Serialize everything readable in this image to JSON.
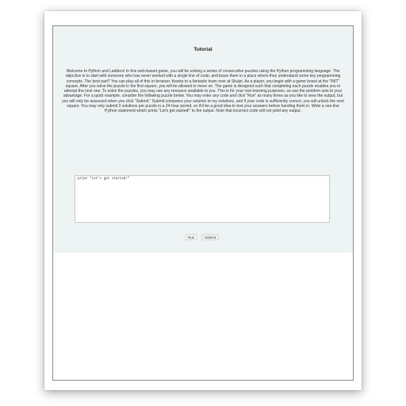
{
  "tutorial": {
    "title": "Tutorial",
    "body": "Welcome to Python and Ladders! In this web-based game, you will be solving a series of consecutive puzzles using the Python programming language. The objective is to start with someone who has never worked with a single line of code, and leave them in a place where they understand some key programming concepts. The best part? You can play all of this in-browser, thanks to a fantastic team over at Skulpt. As a player, you begin with a game board at the \"INIT\" square. After you solve the puzzle in the first square, you will be allowed to move on. The game is designed such that completing each puzzle enables you to attempt the next one. To solve the puzzles, you may use any resource available to you. This is for your own learning purposes, so use the problem sets to your advantage. For a quick example, consider the following puzzle below. You may enter any code and click \"Run\" as many times as you like to view the output, but you will only be assessed when you click \"Submit.\" Submit compares your solution to my solutions, and if your code is sufficiently correct, you will unlock the next square. You may only submit 3 solutions per puzzle in a 24-hour period, so it'd be a good idea to test your answers before handing them in. Write a one-line Python statement which prints \"Let's get started!\" to the output. Note that incorrect code will not yield any output."
  },
  "editor": {
    "value": "print \"Let's get started!\""
  },
  "actions": {
    "run_label": "Run",
    "submit_label": "Submit"
  }
}
